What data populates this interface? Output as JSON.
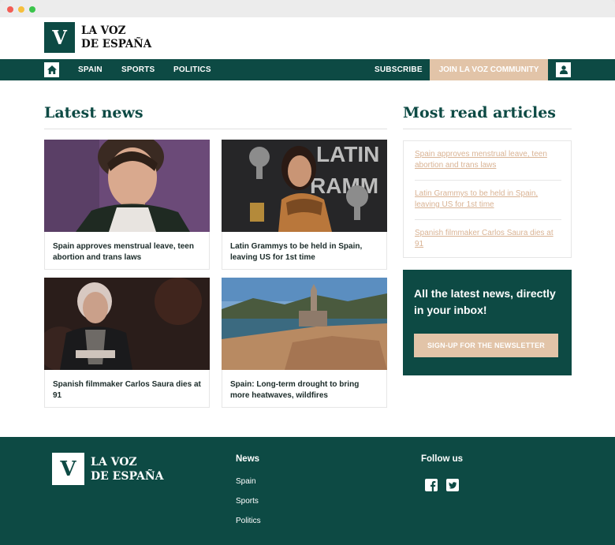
{
  "brand": {
    "mark": "V",
    "line1": "LA VOZ",
    "line2": "DE ESPAÑA"
  },
  "nav": {
    "items": [
      "SPAIN",
      "SPORTS",
      "POLITICS"
    ],
    "subscribe": "SUBSCRIBE",
    "join": "JOIN LA VOZ COMMUNITY"
  },
  "latest": {
    "title": "Latest news",
    "cards": [
      "Spain approves menstrual leave, teen abortion and trans laws",
      "Latin Grammys to be held in Spain, leaving US for 1st time",
      "Spanish filmmaker Carlos Saura dies at 91",
      "Spain: Long-term drought to bring more heatwaves, wildfires"
    ]
  },
  "mostread": {
    "title": "Most read articles",
    "items": [
      "Spain approves menstrual leave, teen abortion and trans laws",
      "Latin Grammys to be held in Spain, leaving US for 1st time",
      "Spanish filmmaker Carlos Saura dies at 91"
    ]
  },
  "newsletter": {
    "text": "All the latest news, directly in your inbox!",
    "button": "SIGN-UP FOR THE NEWSLETTER"
  },
  "footer": {
    "news_heading": "News",
    "links": [
      "Spain",
      "Sports",
      "Politics"
    ],
    "follow_heading": "Follow us",
    "social_icons": [
      "facebook-icon",
      "twitter-icon"
    ]
  },
  "colors": {
    "primary": "#0d4a44",
    "accent": "#e2c4a8",
    "link": "#d9b394"
  }
}
